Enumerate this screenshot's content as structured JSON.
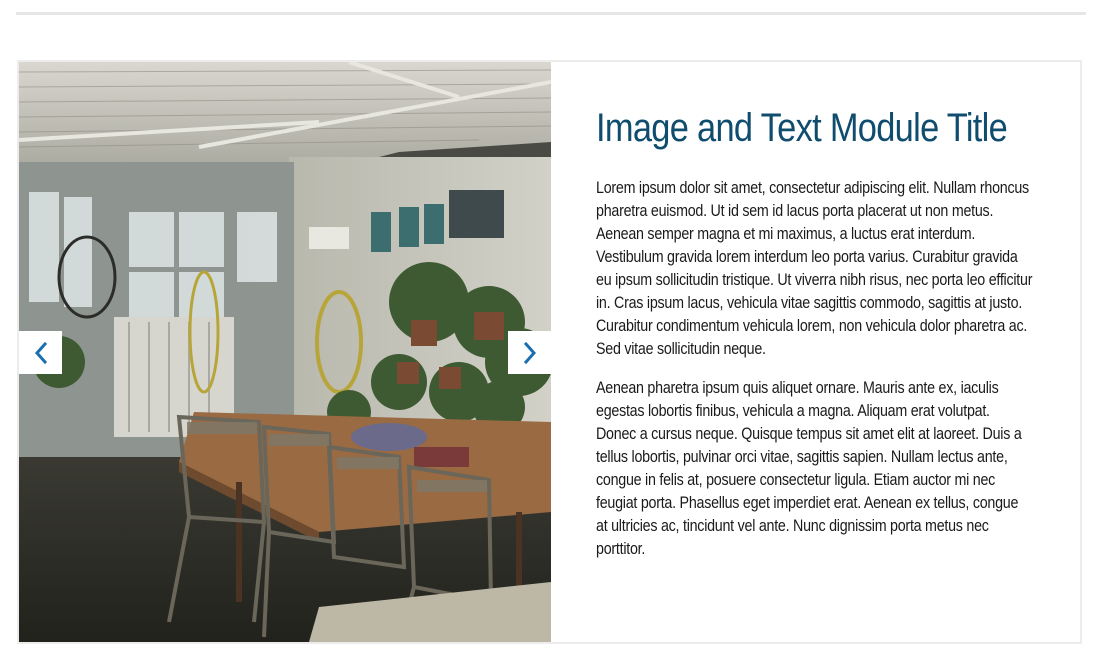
{
  "module": {
    "title": "Image and Text Module Title",
    "paragraphs": [
      "Lorem ipsum dolor sit amet, consectetur adipiscing elit. Nullam rhoncus pharetra euismod. Ut id sem id lacus porta placerat ut non metus. Aenean semper magna et mi maximus, a luctus erat interdum. Vestibulum gravida lorem interdum leo porta varius. Curabitur gravida eu ipsum sollicitudin tristique. Ut viverra nibh risus, nec porta leo efficitur in. Cras ipsum lacus, vehicula vitae sagittis commodo, sagittis at justo. Curabitur condimentum vehicula lorem, non vehicula dolor pharetra ac. Sed vitae sollicitudin neque.",
      "Aenean pharetra ipsum quis aliquet ornare. Mauris ante ex, iaculis egestas lobortis finibus, vehicula a magna. Aliquam erat volutpat. Donec a cursus neque. Quisque tempus sit amet elit at laoreet. Duis a tellus lobortis, pulvinar orci vitae, sagittis sapien. Nullam lectus ante, congue in felis at, posuere consectetur ligula. Etiam auctor mi nec feugiat porta. Phasellus eget imperdiet erat. Aenean ex tellus, congue at ultricies ac, tincidunt vel ante. Nunc dignissim porta metus nec porttitor."
    ]
  },
  "carousel": {
    "prev_icon": "chevron-left-icon",
    "next_icon": "chevron-right-icon"
  },
  "colors": {
    "accent": "#0f4c6e",
    "arrow": "#1a6fb0",
    "text": "#1a1a1a",
    "border": "#ececec"
  }
}
